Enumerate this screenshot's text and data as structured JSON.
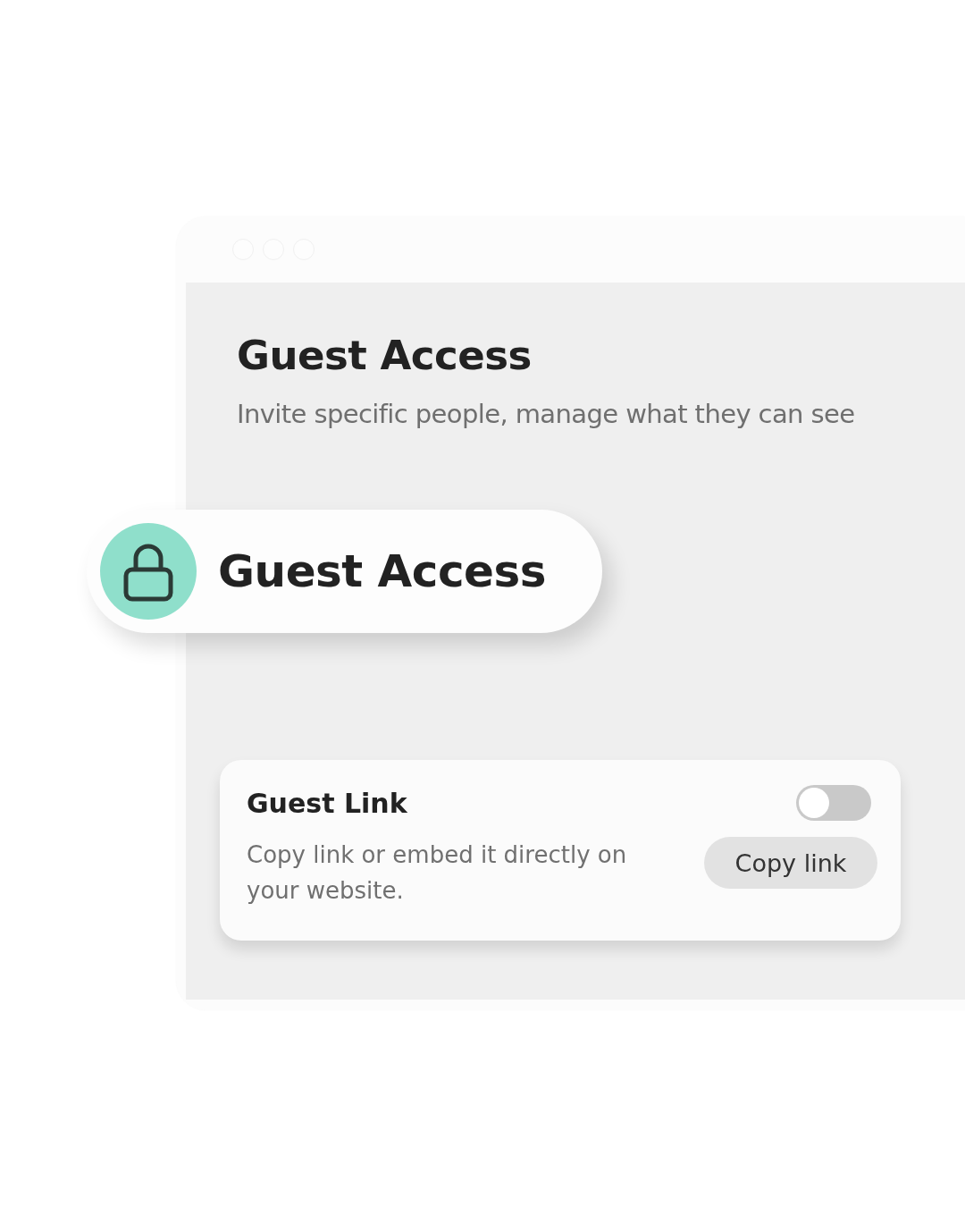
{
  "page": {
    "title": "Guest Access",
    "subtitle": "Invite specific people, manage what they can see"
  },
  "badge": {
    "label": "Guest Access"
  },
  "guest_link": {
    "title": "Guest Link",
    "toggle": {
      "on": false
    },
    "description": "Copy link or embed it directly on your website.",
    "button": "Copy link"
  }
}
